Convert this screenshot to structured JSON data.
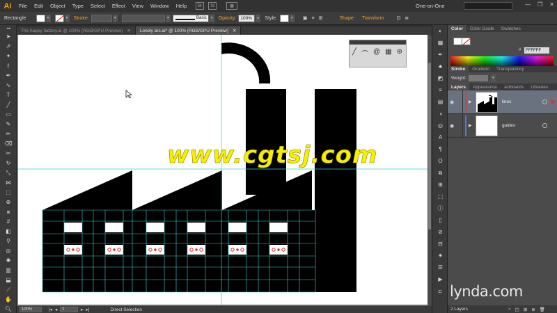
{
  "app": {
    "logo": "Ai",
    "workspace": "One-on-One"
  },
  "menubar": {
    "items": [
      "File",
      "Edit",
      "Object",
      "Type",
      "Select",
      "Effect",
      "View",
      "Window",
      "Help"
    ],
    "bridge_label": "Br",
    "stock_label": "St"
  },
  "control_bar": {
    "object_type": "Rectangle",
    "stroke_label": "Stroke:",
    "stroke_profile": "Basic",
    "opacity_label": "Opacity:",
    "opacity_value": "100%",
    "style_label": "Style:",
    "shape_label": "Shape:",
    "transform_label": "Transform"
  },
  "doc_tabs": [
    {
      "label": "The happy factory.ai @ 100% (RGB/GPU Preview)",
      "active": false
    },
    {
      "label": "Lonely arc.ai* @ 100% (RGB/GPU Preview)",
      "active": true
    }
  ],
  "watermark": "www.cgtsj.com",
  "status_bar": {
    "zoom": "100%",
    "artboard": "1",
    "tool": "Direct Selection"
  },
  "panels": {
    "color_tabs": [
      "Color",
      "Color Guide",
      "Swatches"
    ],
    "hex_value": "FFFFFF",
    "stroke_tabs": [
      "Stroke",
      "Gradient",
      "Transparency"
    ],
    "weight_label": "Weight:",
    "layer_tabs": [
      "Layers",
      "Appearance",
      "Artboards",
      "Libraries"
    ],
    "layers": [
      {
        "name": "lines",
        "color": "#d04040",
        "selected": true
      },
      {
        "name": "guides",
        "color": "#4f7bd6",
        "selected": false
      }
    ],
    "layer_count": "2 Layers"
  },
  "brand": "lynda.com",
  "colors": {
    "accent": "#f7a21b",
    "guide": "#39d0d0",
    "watermark": "#f5f000"
  }
}
